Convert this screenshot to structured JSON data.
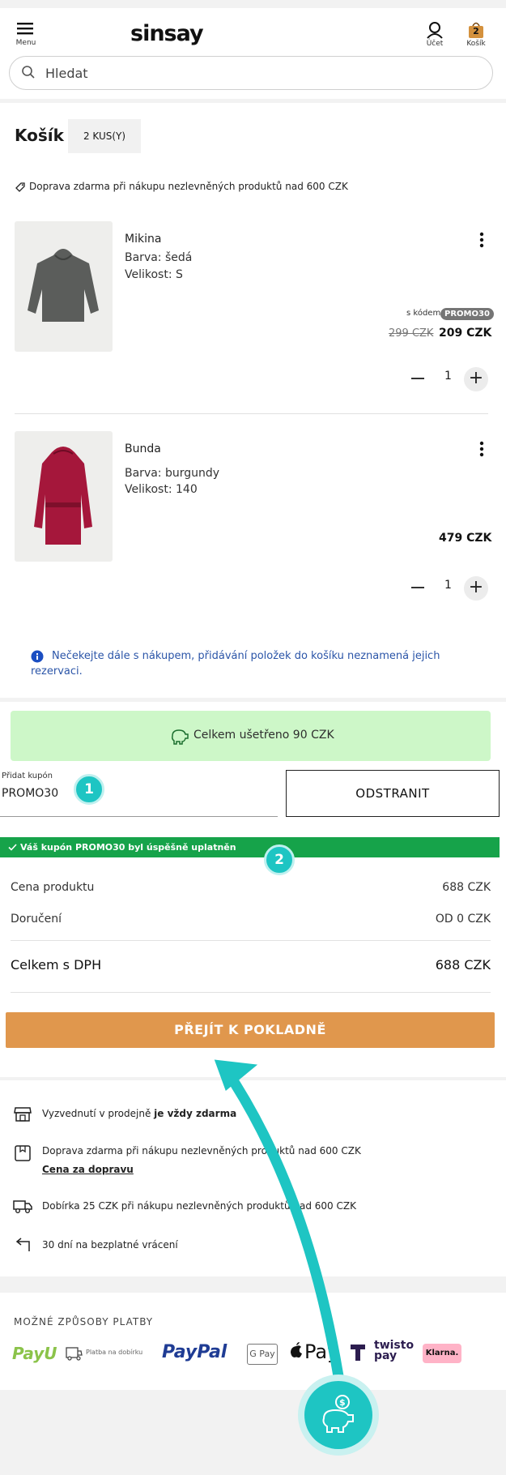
{
  "header": {
    "menu_label": "Menu",
    "logo": "sinsay",
    "account_label": "Účet",
    "cart_label": "Košík",
    "cart_count": "2"
  },
  "search": {
    "placeholder": "Hledat"
  },
  "cart": {
    "title": "Košík",
    "count_label": "2 KUS(Y)",
    "free_shipping_note": "Doprava zdarma při nákupu nezlevněných produktů nad 600 CZK",
    "items": [
      {
        "name": "Mikina",
        "color": "Barva: šedá",
        "size": "Velikost: S",
        "code_label": "s kódem",
        "code": "PROMO30",
        "old_price": "299 CZK",
        "price": "209 CZK",
        "qty": "1"
      },
      {
        "name": "Bunda",
        "color": "Barva: burgundy",
        "size": "Velikost: 140",
        "price": "479 CZK",
        "qty": "1"
      }
    ],
    "reservation_info": "Nečekejte dále s nákupem, přidávání položek do košíku neznamená jejich rezervaci."
  },
  "savings": {
    "text": "Celkem ušetřeno 90 CZK"
  },
  "coupon": {
    "label": "Přidat kupón",
    "value": "PROMO30",
    "remove_label": "ODSTRANIT",
    "success_message": "Váš kupón PROMO30 byl úspěšně uplatněn",
    "step1": "1",
    "step2": "2"
  },
  "summary": {
    "product_label": "Cena produktu",
    "product_value": "688 CZK",
    "delivery_label": "Doručení",
    "delivery_value": "OD 0 CZK",
    "total_label": "Celkem s DPH",
    "total_value": "688 CZK"
  },
  "checkout": {
    "label": "PŘEJÍT K POKLADNĚ"
  },
  "perks": [
    {
      "text": "Vyzvednutí v prodejně",
      "bold": "je vždy zdarma"
    },
    {
      "text": "Doprava zdarma při nákupu nezlevněných produktů nad 600 CZK",
      "link": "Cena za dopravu"
    },
    {
      "text": "Dobírka 25 CZK při nákupu nezlevněných produktů nad 600 CZK"
    },
    {
      "text": "30 dní na bezplatné vrácení"
    }
  ],
  "payment": {
    "title": "MOŽNÉ ZPŮSOBY PLATBY",
    "methods": [
      "PayU",
      "Platba na dobírku",
      "PayPal",
      "G Pay",
      "Pay",
      "twisto pay",
      "Klarna."
    ]
  },
  "colors": {
    "accent_checkout": "#e0974d",
    "success_green": "#16a34a",
    "teal_annotation": "#1ec5c3",
    "savings_bg": "#cdf7c8",
    "info_blue": "#2b55a8"
  }
}
